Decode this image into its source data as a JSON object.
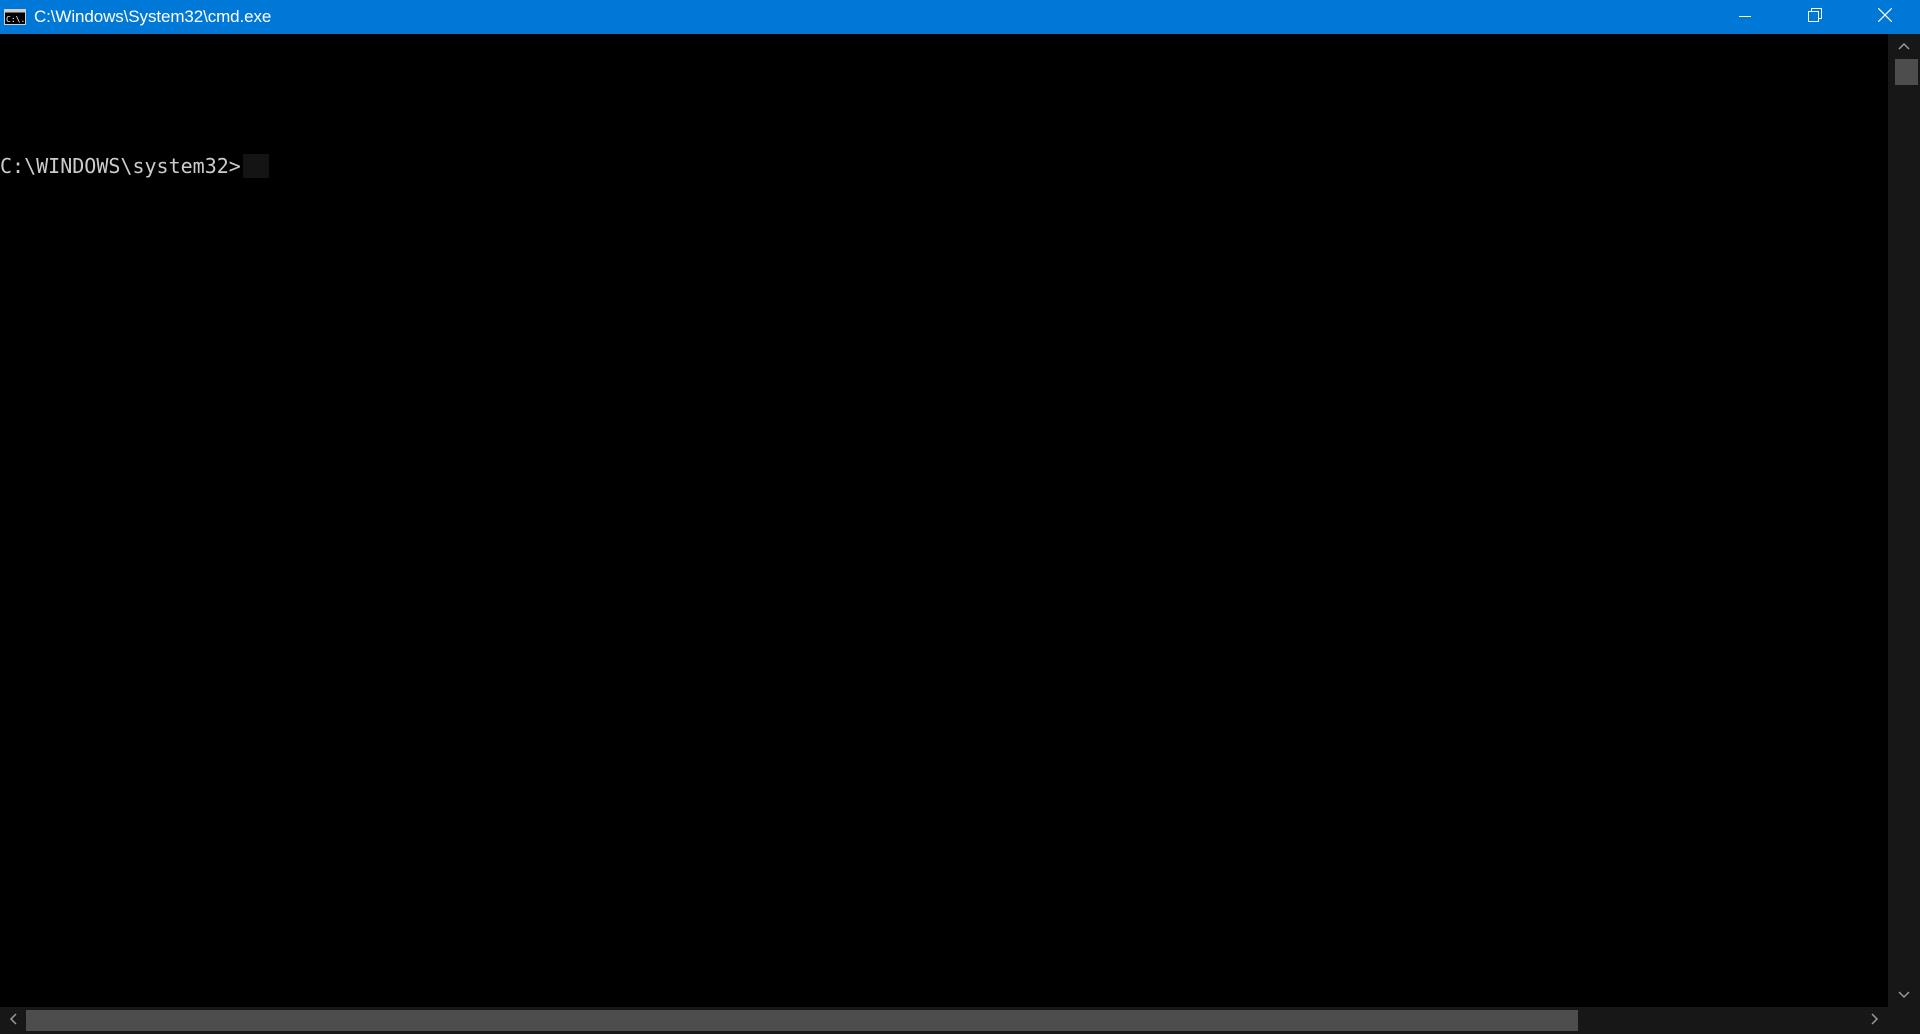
{
  "window": {
    "title": "C:\\Windows\\System32\\cmd.exe",
    "accent_color": "#0078d7",
    "icon": "cmd-app-icon",
    "icon_text": "C:\\."
  },
  "caption": {
    "minimize_icon": "minimize-icon",
    "restore_icon": "restore-icon",
    "close_icon": "close-icon"
  },
  "console": {
    "prompt": "C:\\WINDOWS\\system32>",
    "background": "#000000",
    "foreground": "#cccccc"
  },
  "scrollbars": {
    "up_icon": "chevron-up-icon",
    "down_icon": "chevron-down-icon",
    "left_icon": "chevron-left-icon",
    "right_icon": "chevron-right-icon"
  }
}
